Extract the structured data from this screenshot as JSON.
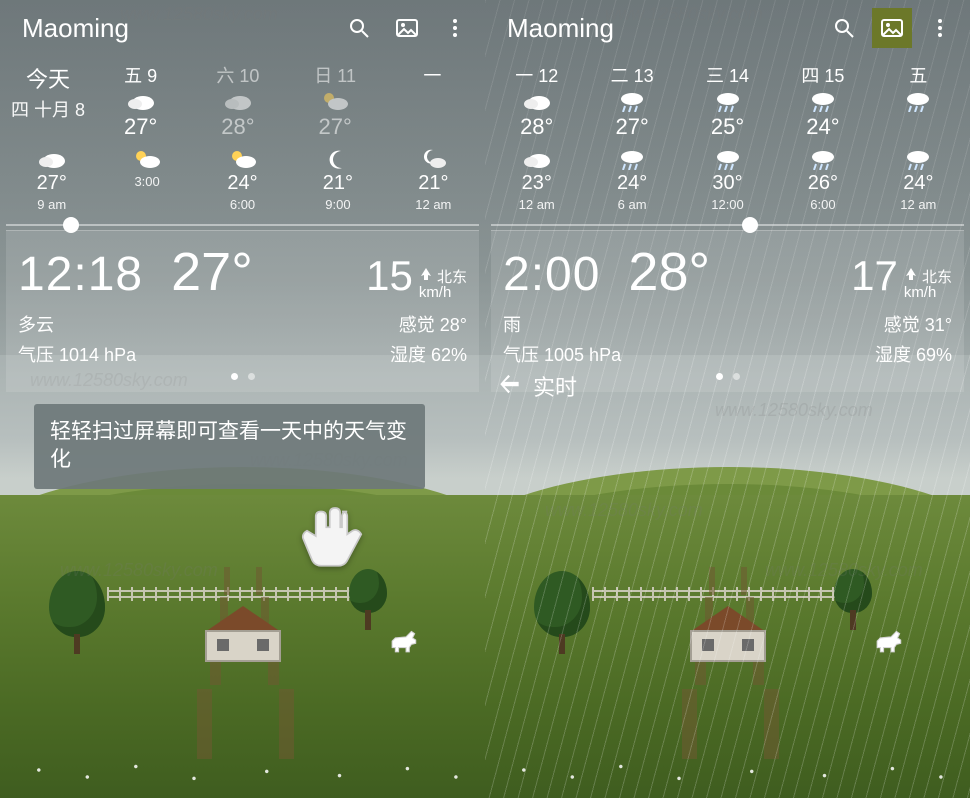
{
  "watermark": "www.12580sky.com",
  "left": {
    "city": "Maoming",
    "today": {
      "label": "今天",
      "date": "四 十月 8"
    },
    "days": [
      {
        "label": "五 9",
        "temp": "27°",
        "icon": "cloudy"
      },
      {
        "label": "六 10",
        "temp": "28°",
        "icon": "cloudy",
        "dim": true
      },
      {
        "label": "日 11",
        "temp": "27°",
        "icon": "partly",
        "dim": true
      },
      {
        "label": "一",
        "temp": "",
        "icon": "none"
      }
    ],
    "hours": [
      {
        "icon": "cloudy",
        "temp": "27°",
        "label": "9 am"
      },
      {
        "icon": "partly",
        "temp": "",
        "label": "3:00"
      },
      {
        "icon": "partly",
        "temp": "24°",
        "label": "6:00"
      },
      {
        "icon": "moon",
        "temp": "21°",
        "label": "9:00"
      },
      {
        "icon": "mooncloud",
        "temp": "21°",
        "label": "12 am"
      }
    ],
    "scrubPos": "12%",
    "card": {
      "time": "12:18",
      "temp": "27°",
      "wind": "15",
      "windUnit": "km/h",
      "windDir": "北东",
      "cond": "多云",
      "feelsLabel": "感觉",
      "feels": "28°",
      "pressureLabel": "气压",
      "pressure": "1014 hPa",
      "humidityLabel": "湿度",
      "humidity": "62%"
    },
    "tip": "轻轻扫过屏幕即可查看一天中的天气变化"
  },
  "right": {
    "city": "Maoming",
    "days": [
      {
        "label": "一 12",
        "temp": "28°",
        "icon": "cloudy"
      },
      {
        "label": "二 13",
        "temp": "27°",
        "icon": "rain"
      },
      {
        "label": "三 14",
        "temp": "25°",
        "icon": "rain"
      },
      {
        "label": "四 15",
        "temp": "24°",
        "icon": "rain"
      },
      {
        "label": "五",
        "temp": "",
        "icon": "rain"
      }
    ],
    "hours": [
      {
        "icon": "cloudy",
        "temp": "23°",
        "label": "12 am"
      },
      {
        "icon": "rain",
        "temp": "24°",
        "label": "6 am"
      },
      {
        "icon": "rain",
        "temp": "30°",
        "label": "12:00"
      },
      {
        "icon": "rain",
        "temp": "26°",
        "label": "6:00"
      },
      {
        "icon": "rain",
        "temp": "24°",
        "label": "12 am"
      }
    ],
    "scrubPos": "53%",
    "card": {
      "time": "2:00",
      "temp": "28°",
      "wind": "17",
      "windUnit": "km/h",
      "windDir": "北东",
      "cond": "雨",
      "feelsLabel": "感觉",
      "feels": "31°",
      "pressureLabel": "气压",
      "pressure": "1005 hPa",
      "humidityLabel": "湿度",
      "humidity": "69%"
    },
    "back": "实时"
  }
}
